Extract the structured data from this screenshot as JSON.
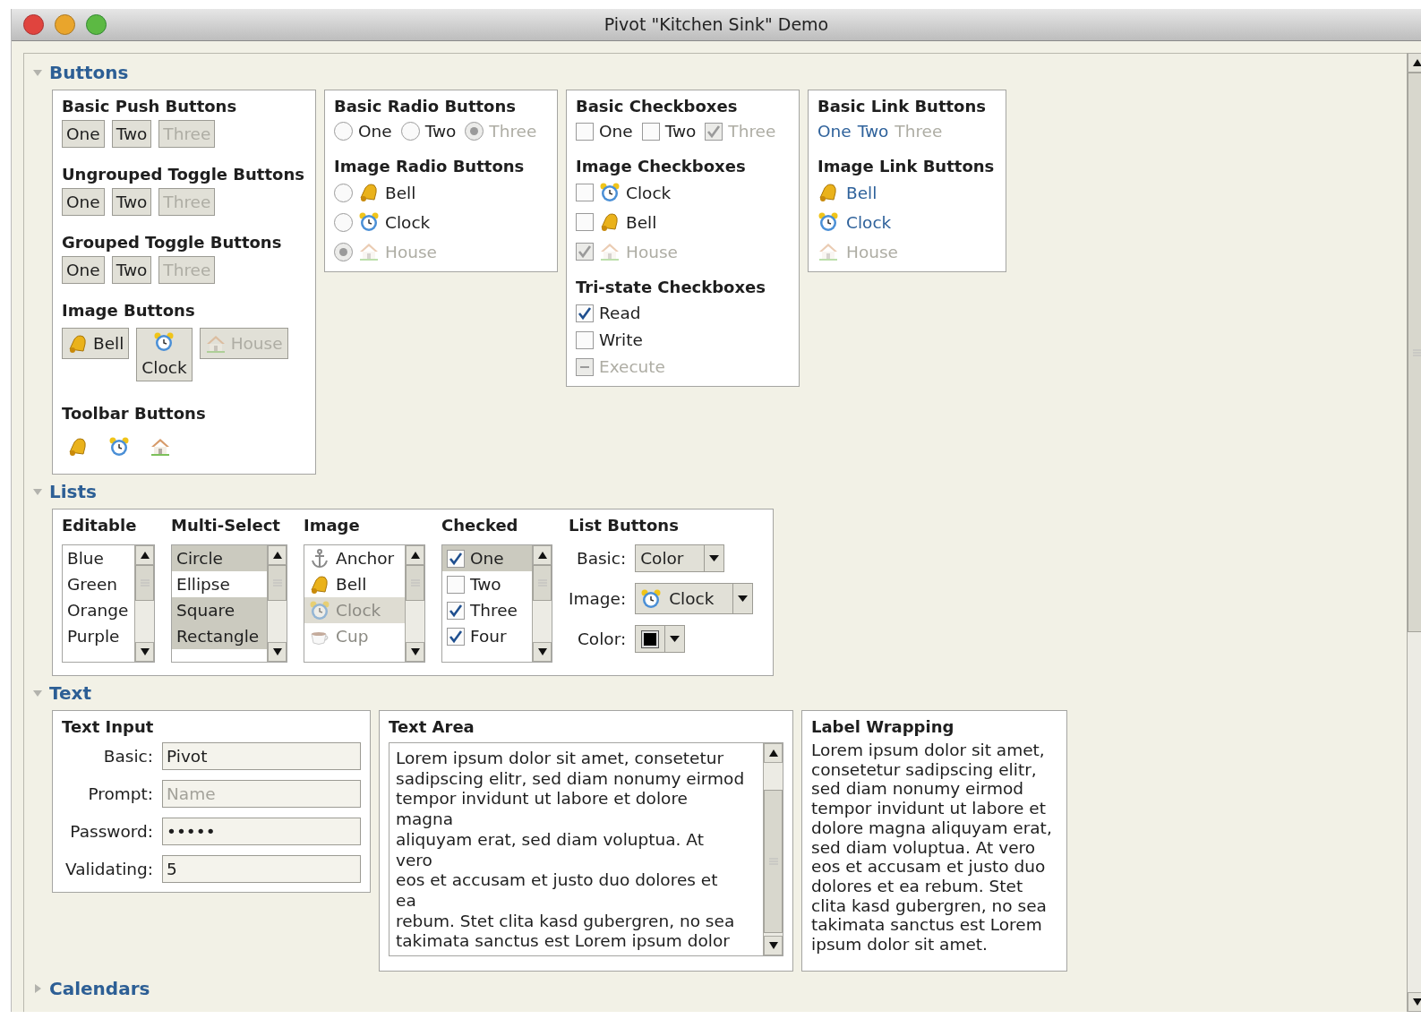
{
  "window": {
    "title": "Pivot \"Kitchen Sink\" Demo"
  },
  "buttons": {
    "title": "Buttons",
    "expanded": true,
    "push_buttons": {
      "title": "Basic Push Buttons",
      "buttons": [
        {
          "label": "One",
          "disabled": false
        },
        {
          "label": "Two",
          "disabled": false
        },
        {
          "label": "Three",
          "disabled": true
        }
      ]
    },
    "ungrouped_toggle": {
      "title": "Ungrouped Toggle Buttons",
      "buttons": [
        {
          "label": "One",
          "disabled": false
        },
        {
          "label": "Two",
          "disabled": false
        },
        {
          "label": "Three",
          "disabled": true
        }
      ]
    },
    "grouped_toggle": {
      "title": "Grouped Toggle Buttons",
      "buttons": [
        {
          "label": "One",
          "disabled": false
        },
        {
          "label": "Two",
          "disabled": false
        },
        {
          "label": "Three",
          "disabled": true
        }
      ]
    },
    "image_buttons": {
      "title": "Image Buttons",
      "buttons": [
        {
          "label": "Bell",
          "kind": "bell",
          "disabled": false
        },
        {
          "label": "Clock",
          "kind": "clock",
          "disabled": false
        },
        {
          "label": "House",
          "kind": "house",
          "disabled": true
        }
      ]
    },
    "toolbar_buttons": {
      "title": "Toolbar Buttons",
      "buttons": [
        {
          "kind": "bell"
        },
        {
          "kind": "clock"
        },
        {
          "kind": "house"
        }
      ]
    },
    "basic_radio": {
      "title": "Basic Radio Buttons",
      "options": [
        {
          "label": "One",
          "selected": false,
          "disabled": false
        },
        {
          "label": "Two",
          "selected": false,
          "disabled": false
        },
        {
          "label": "Three",
          "selected": true,
          "disabled": true
        }
      ]
    },
    "image_radio": {
      "title": "Image Radio Buttons",
      "options": [
        {
          "label": "Bell",
          "kind": "bell",
          "selected": false,
          "disabled": false
        },
        {
          "label": "Clock",
          "kind": "clock",
          "selected": false,
          "disabled": false
        },
        {
          "label": "House",
          "kind": "house",
          "selected": true,
          "disabled": true
        }
      ]
    },
    "basic_checkboxes": {
      "title": "Basic Checkboxes",
      "items": [
        {
          "label": "One",
          "checked": false,
          "disabled": false
        },
        {
          "label": "Two",
          "checked": false,
          "disabled": false
        },
        {
          "label": "Three",
          "checked": true,
          "disabled": true
        }
      ]
    },
    "image_checkboxes": {
      "title": "Image Checkboxes",
      "items": [
        {
          "label": "Clock",
          "kind": "clock",
          "checked": false,
          "disabled": false
        },
        {
          "label": "Bell",
          "kind": "bell",
          "checked": false,
          "disabled": false
        },
        {
          "label": "House",
          "kind": "house",
          "checked": true,
          "disabled": true
        }
      ]
    },
    "tristate_checkboxes": {
      "title": "Tri-state Checkboxes",
      "items": [
        {
          "label": "Read",
          "checked": true,
          "indeterminate": false,
          "disabled": false
        },
        {
          "label": "Write",
          "checked": false,
          "indeterminate": false,
          "disabled": false
        },
        {
          "label": "Execute",
          "checked": false,
          "indeterminate": true,
          "disabled": true
        }
      ]
    },
    "basic_links": {
      "title": "Basic Link Buttons",
      "links": [
        {
          "label": "One",
          "disabled": false
        },
        {
          "label": "Two",
          "disabled": false
        },
        {
          "label": "Three",
          "disabled": true
        }
      ]
    },
    "image_links": {
      "title": "Image Link Buttons",
      "links": [
        {
          "label": "Bell",
          "kind": "bell",
          "disabled": false
        },
        {
          "label": "Clock",
          "kind": "clock",
          "disabled": false
        },
        {
          "label": "House",
          "kind": "house",
          "disabled": true
        }
      ]
    }
  },
  "lists": {
    "title": "Lists",
    "expanded": true,
    "editable": {
      "title": "Editable",
      "items": [
        {
          "label": "Blue",
          "selected": false
        },
        {
          "label": "Green",
          "selected": false
        },
        {
          "label": "Orange",
          "selected": false
        },
        {
          "label": "Purple",
          "selected": false
        }
      ]
    },
    "multi_select": {
      "title": "Multi-Select",
      "items": [
        {
          "label": "Circle",
          "selected": true
        },
        {
          "label": "Ellipse",
          "selected": false
        },
        {
          "label": "Square",
          "selected": true
        },
        {
          "label": "Rectangle",
          "selected": true
        }
      ]
    },
    "image": {
      "title": "Image",
      "items": [
        {
          "label": "Anchor",
          "kind": "anchor",
          "selected": false,
          "disabled": false
        },
        {
          "label": "Bell",
          "kind": "bell",
          "selected": false,
          "disabled": false
        },
        {
          "label": "Clock",
          "kind": "clock",
          "selected": true,
          "disabled": true
        },
        {
          "label": "Cup",
          "kind": "cup",
          "selected": false,
          "disabled": true
        }
      ]
    },
    "checked": {
      "title": "Checked",
      "items": [
        {
          "label": "One",
          "checked": true,
          "selected": true
        },
        {
          "label": "Two",
          "checked": false,
          "selected": false
        },
        {
          "label": "Three",
          "checked": true,
          "selected": false
        },
        {
          "label": "Four",
          "checked": true,
          "selected": false
        }
      ]
    },
    "list_buttons": {
      "title": "List Buttons",
      "rows": [
        {
          "label": "Basic:",
          "kind": "text",
          "value": "Color"
        },
        {
          "label": "Image:",
          "kind": "clock",
          "value": "Clock"
        },
        {
          "label": "Color:",
          "kind": "color",
          "color": "#000000"
        }
      ]
    }
  },
  "text": {
    "title": "Text",
    "expanded": true,
    "text_input": {
      "title": "Text Input",
      "fields": [
        {
          "label": "Basic:",
          "value": "Pivot"
        },
        {
          "label": "Prompt:",
          "placeholder": "Name"
        },
        {
          "label": "Password:",
          "value": "•••••"
        },
        {
          "label": "Validating:",
          "value": "5"
        }
      ]
    },
    "text_area": {
      "title": "Text Area",
      "lines": [
        "Lorem ipsum dolor sit amet, consetetur",
        "sadipscing elitr, sed diam nonumy eirmod",
        "tempor invidunt ut labore et dolore",
        "magna",
        "aliquyam erat, sed diam voluptua. At",
        "vero",
        "eos et accusam et justo duo dolores et",
        "ea",
        "rebum. Stet clita kasd gubergren, no sea",
        "takimata sanctus est Lorem ipsum dolor"
      ]
    },
    "label_wrapping": {
      "title": "Label Wrapping",
      "text": "Lorem ipsum dolor sit amet, consetetur sadipscing elitr, sed diam nonumy eirmod tempor invidunt ut labore et dolore magna aliquyam erat, sed diam voluptua. At vero eos et accusam et justo duo dolores et ea rebum. Stet clita kasd gubergren, no sea takimata sanctus est Lorem ipsum dolor sit amet."
    }
  },
  "calendars": {
    "title": "Calendars",
    "expanded": false
  }
}
